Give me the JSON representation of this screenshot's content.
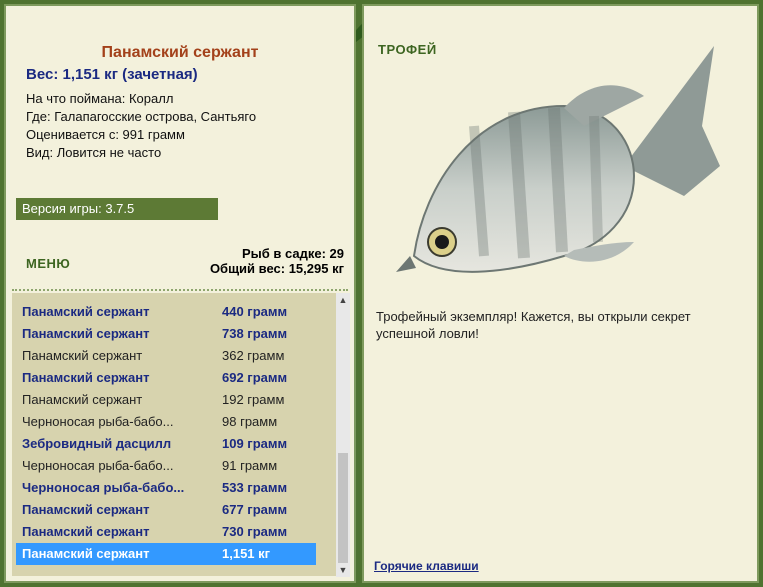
{
  "catch": {
    "name": "Панамский сержант",
    "weight": "Вес: 1,151 кг (зачетная)",
    "info": [
      "На что поймана: Коралл",
      "Где: Галапагосские острова, Сантьяго",
      "Оценивается с: 991 грамм",
      "Вид: Ловится не часто"
    ]
  },
  "version": "Версия игры: 3.7.5",
  "menu_label": "МЕНЮ",
  "stats": {
    "fish_in_cage": "Рыб в садке: 29",
    "total_weight": "Общий вес: 15,295 кг"
  },
  "list": [
    {
      "name": "Панамский сержант",
      "weight": "440 грамм",
      "style": "bold"
    },
    {
      "name": "Панамский сержант",
      "weight": "738 грамм",
      "style": "bold"
    },
    {
      "name": "Панамский сержант",
      "weight": "362 грамм",
      "style": "plain"
    },
    {
      "name": "Панамский сержант",
      "weight": "692 грамм",
      "style": "bold"
    },
    {
      "name": "Панамский сержант",
      "weight": "192 грамм",
      "style": "plain"
    },
    {
      "name": "Черноносая рыба-бабо...",
      "weight": "98 грамм",
      "style": "plain"
    },
    {
      "name": "Зебровидный дасцилл",
      "weight": "109 грамм",
      "style": "bold"
    },
    {
      "name": "Черноносая рыба-бабо...",
      "weight": "91 грамм",
      "style": "plain"
    },
    {
      "name": "Черноносая рыба-бабо...",
      "weight": "533 грамм",
      "style": "bold"
    },
    {
      "name": "Панамский сержант",
      "weight": "677 грамм",
      "style": "bold"
    },
    {
      "name": "Панамский сержант",
      "weight": "730 грамм",
      "style": "bold"
    },
    {
      "name": "Панамский сержант",
      "weight": "1,151 кг",
      "style": "sel"
    }
  ],
  "trophy": {
    "title": "ТРОФЕЙ",
    "message": "Трофейный экземпляр! Кажется, вы открыли секрет успешной ловли!",
    "hotkeys": "Горячие клавиши"
  },
  "colors": {
    "frame": "#4f7330",
    "panel": "#f3f1dc",
    "title": "#a3411a",
    "accent": "#1b2a82",
    "selected": "#3399ff"
  },
  "icons": {
    "scroll_up": "▲",
    "scroll_down": "▼"
  }
}
